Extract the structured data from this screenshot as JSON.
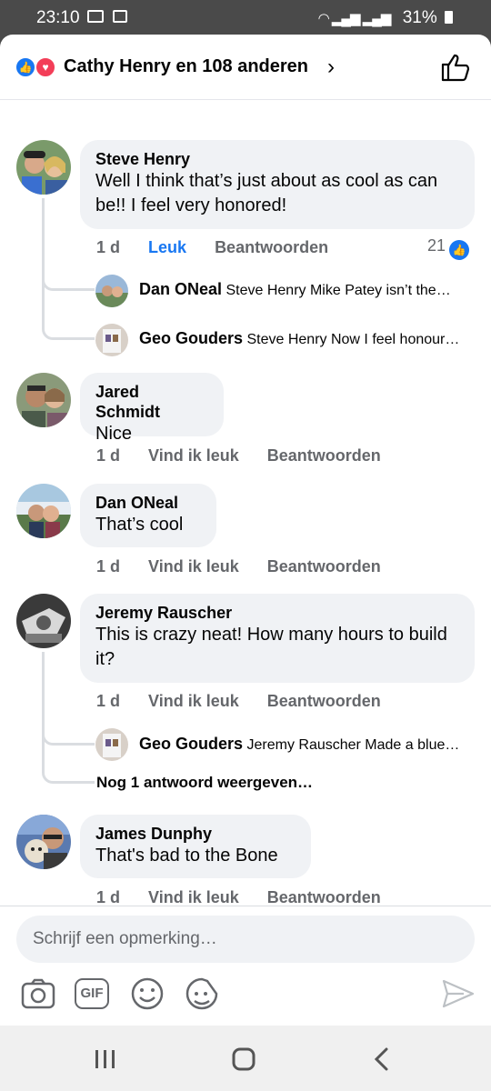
{
  "status": {
    "time": "23:10",
    "battery": "31%"
  },
  "header": {
    "title": "Cathy Henry en 108 anderen"
  },
  "comments": [
    {
      "name": "Steve Henry",
      "text": "Well I think that’s just about as cool as can be!! I feel very honored!",
      "time": "1 d",
      "like_label": "Leuk",
      "reply_label": "Beantwoorden",
      "like_count": "21",
      "replies": [
        {
          "name": "Dan ONeal",
          "text": "Steve Henry Mike Patey isn’t the…"
        },
        {
          "name": "Geo Gouders",
          "text": "Steve Henry Now I feel honour…"
        }
      ]
    },
    {
      "name": "Jared Schmidt",
      "text": "Nice",
      "time": "1 d",
      "like_label": "Vind ik leuk",
      "reply_label": "Beantwoorden"
    },
    {
      "name": "Dan ONeal",
      "text": "That’s cool",
      "time": "1 d",
      "like_label": "Vind ik leuk",
      "reply_label": "Beantwoorden"
    },
    {
      "name": "Jeremy Rauscher",
      "text": "This is crazy neat!  How many hours to build it?",
      "time": "1 d",
      "like_label": "Vind ik leuk",
      "reply_label": "Beantwoorden",
      "replies": [
        {
          "name": "Geo Gouders",
          "text": "Jeremy Rauscher Made a blue…"
        }
      ],
      "more_replies": "Nog 1 antwoord weergeven…"
    },
    {
      "name": "James Dunphy",
      "text": "That's bad to the Bone",
      "time": "1 d",
      "like_label": "Vind ik leuk",
      "reply_label": "Beantwoorden"
    }
  ],
  "composer": {
    "placeholder": "Schrijf een opmerking…",
    "gif_label": "GIF"
  }
}
